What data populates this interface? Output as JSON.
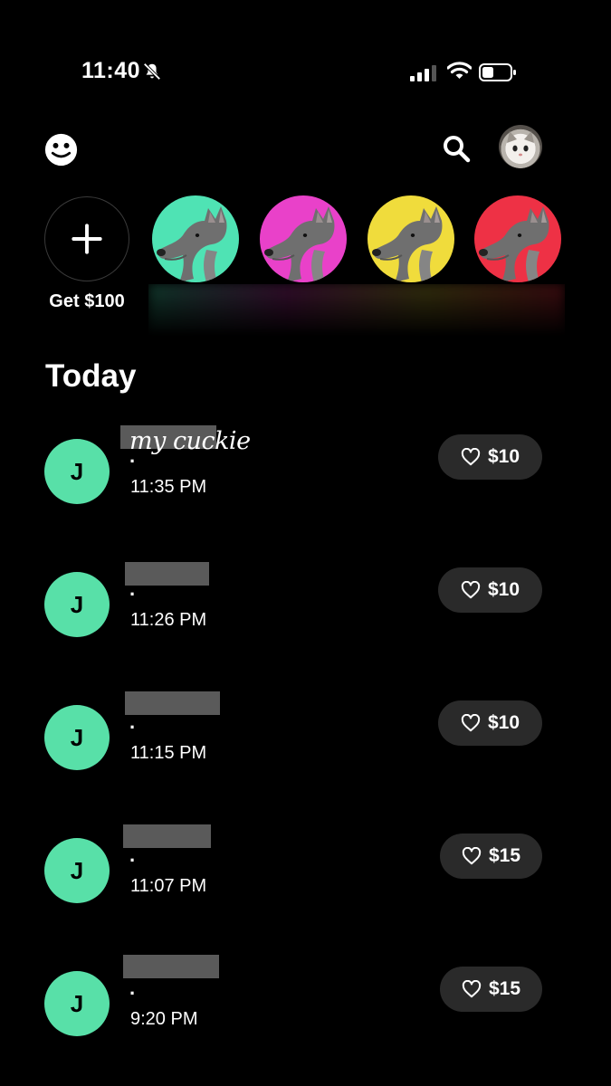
{
  "status_bar": {
    "time": "11:40"
  },
  "header": {
    "left_icon": "smiley-icon",
    "right_icons": [
      "search-icon",
      "profile-avatar"
    ]
  },
  "stories": {
    "add_label": "Get $100",
    "items": [
      {
        "icon": "wolf-avatar",
        "bg": "#4fe3b4"
      },
      {
        "icon": "wolf-avatar",
        "bg": "#e941c9"
      },
      {
        "icon": "wolf-avatar",
        "bg": "#f0dc3c"
      },
      {
        "icon": "wolf-avatar",
        "bg": "#ee3145"
      }
    ]
  },
  "section_title": "Today",
  "overlay_text": "my cuckie",
  "activity": [
    {
      "initial": "J",
      "subtitle": ".",
      "time": "11:35 PM",
      "amount": "$10"
    },
    {
      "initial": "J",
      "subtitle": ".",
      "time": "11:26 PM",
      "amount": "$10"
    },
    {
      "initial": "J",
      "subtitle": ".",
      "time": "11:15 PM",
      "amount": "$10"
    },
    {
      "initial": "J",
      "subtitle": ".",
      "time": "11:07 PM",
      "amount": "$15"
    },
    {
      "initial": "J",
      "subtitle": ".",
      "time": "9:20 PM",
      "amount": "$15"
    }
  ],
  "colors": {
    "avatar_green": "#58e0a8",
    "pill_bg": "#2a2a2a",
    "background": "#000000"
  }
}
